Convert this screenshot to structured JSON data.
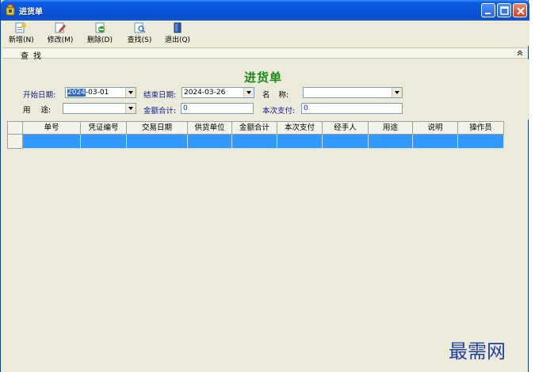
{
  "window": {
    "title": "进货单"
  },
  "toolbar": {
    "items": [
      {
        "label": "新增(N)",
        "icon": "new-icon"
      },
      {
        "label": "修改(M)",
        "icon": "edit-icon"
      },
      {
        "label": "删除(D)",
        "icon": "delete-icon"
      },
      {
        "label": "查找(S)",
        "icon": "find-icon"
      },
      {
        "label": "退出(Q)",
        "icon": "exit-icon"
      }
    ]
  },
  "search_panel": {
    "label": "查找"
  },
  "form": {
    "title": "进货单",
    "start_date_label": "开始日期:",
    "start_date_highlight": "2024",
    "start_date_rest": "-03-01",
    "end_date_label": "结束日期:",
    "end_date_value": "2024-03-26",
    "name_label": "名 称:",
    "name_value": "",
    "purpose_label": "用 途:",
    "purpose_value": "",
    "total_label": "金额合计:",
    "total_value": "0",
    "payment_label": "本次支付:",
    "payment_value": "0"
  },
  "table": {
    "columns": [
      "单号",
      "凭证编号",
      "交易日期",
      "供货单位",
      "金额合计",
      "本次支付",
      "经手人",
      "用途",
      "说明",
      "操作员"
    ],
    "rows": [
      [
        "",
        "",
        "",
        "",
        "",
        "",
        "",
        "",
        "",
        ""
      ]
    ]
  },
  "watermark": "最需网",
  "colors": {
    "title_bar": "#0a55d8",
    "form_title": "#1a8a1a",
    "selected_row": "#3399ff",
    "window_bg": "#ecead8",
    "watermark": "#1f3fa8"
  }
}
